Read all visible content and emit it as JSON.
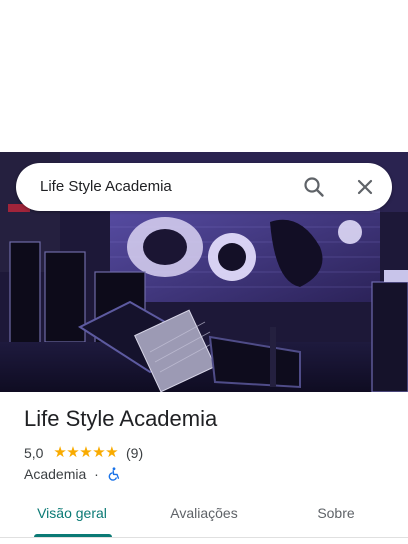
{
  "search": {
    "query": "Life Style Academia"
  },
  "place": {
    "name": "Life Style Academia",
    "rating_text": "5,0",
    "rating_value": 5,
    "stars": "★★★★★",
    "review_count": "(9)",
    "category": "Academia",
    "separator": "·"
  },
  "tabs": [
    {
      "label": "Visão geral",
      "active": true
    },
    {
      "label": "Avaliações",
      "active": false
    },
    {
      "label": "Sobre",
      "active": false
    }
  ],
  "colors": {
    "accent": "#0b7a75",
    "star": "#f9ab00",
    "accessibility": "#1a73e8"
  },
  "icons": {
    "search": "search-icon",
    "close": "close-icon",
    "accessibility": "wheelchair-accessible-icon"
  }
}
